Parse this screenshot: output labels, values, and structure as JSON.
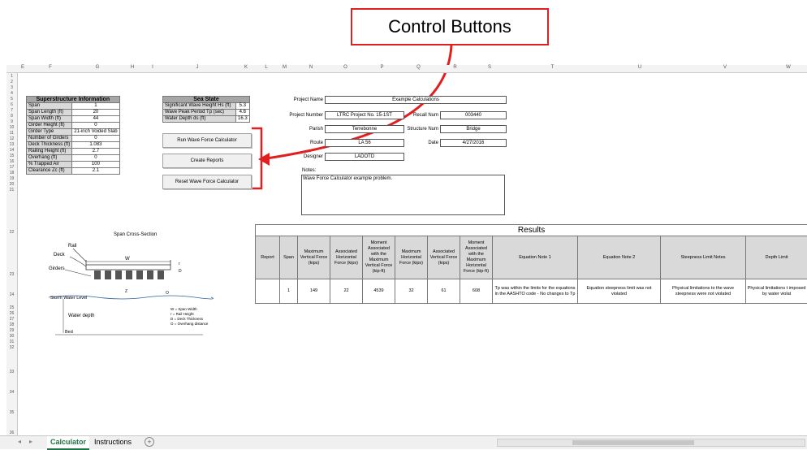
{
  "callout": {
    "label": "Control Buttons"
  },
  "columns": [
    "E",
    "F",
    "G",
    "H",
    "I",
    "J",
    "K",
    "L",
    "M",
    "N",
    "O",
    "P",
    "Q",
    "R",
    "S",
    "T",
    "U",
    "V",
    "W"
  ],
  "rows": [
    "1",
    "2",
    "3",
    "4",
    "5",
    "6",
    "7",
    "8",
    "9",
    "10",
    "11",
    "12",
    "13",
    "14",
    "15",
    "16",
    "17",
    "18",
    "19",
    "20",
    "21",
    "22",
    "23",
    "24",
    "25",
    "26",
    "27",
    "28",
    "29",
    "30",
    "31",
    "32",
    "33",
    "34",
    "35",
    "36"
  ],
  "superstructure": {
    "title": "Superstructure Information",
    "rows": [
      {
        "label": "Span",
        "value": "1"
      },
      {
        "label": "Span Length (ft)",
        "value": "20"
      },
      {
        "label": "Span Width (ft)",
        "value": "44"
      },
      {
        "label": "Girder Height (ft)",
        "value": "0"
      },
      {
        "label": "Girder Type",
        "value": "21-inch Voided Slab"
      },
      {
        "label": "Number of Girders",
        "value": "0"
      },
      {
        "label": "Deck Thickness (ft)",
        "value": "1.083"
      },
      {
        "label": "Railing Height (ft)",
        "value": "2.7"
      },
      {
        "label": "Overhang (ft)",
        "value": "0"
      },
      {
        "label": "% Trapped Air",
        "value": "100"
      },
      {
        "label": "Clearance Zc (ft)",
        "value": "2.1"
      }
    ]
  },
  "sea_state": {
    "title": "Sea State",
    "rows": [
      {
        "label": "Significant Wave Height Hs (ft)",
        "value": "5.3"
      },
      {
        "label": "Wave Peak Period Tp (sec)",
        "value": "4.6"
      },
      {
        "label": "Water Depth ds (ft)",
        "value": "16.3"
      }
    ]
  },
  "buttons": {
    "run": "Run Wave Force Calculator",
    "reports": "Create Reports",
    "reset": "Reset Wave Force Calculator"
  },
  "project": {
    "name_label": "Project Name",
    "name_value": "Example Calculations",
    "number_label": "Project Number",
    "number_value": "LTRC Project No. 15-1ST",
    "recall_label": "Recall Num",
    "recall_value": "003440",
    "parish_label": "Parish",
    "parish_value": "Terrebonne",
    "structure_label": "Structure Num",
    "structure_value": "Bridge",
    "route_label": "Route",
    "route_value": "LA 56",
    "date_label": "Date",
    "date_value": "4/27/2016",
    "designer_label": "Designer",
    "designer_value": "LADOTD",
    "notes_label": "Notes:",
    "notes_value": "Wave Force Calculator example problem."
  },
  "diagram": {
    "title": "Span Cross-Section",
    "rail": "Rail",
    "deck": "Deck",
    "girders": "Girders",
    "w": "W",
    "r": "r",
    "d": "D",
    "storm": "Storm Water Level",
    "zc": "Z",
    "o": "O",
    "water_depth": "Water depth",
    "bed": "Bed",
    "legend": [
      "W = Span Width",
      "r = Rail Height",
      "D = Deck Thickness",
      "O = Overhang distance"
    ]
  },
  "results": {
    "title": "Results",
    "headers": [
      "Report",
      "Span",
      "Maximum Vertical Force (kips)",
      "Associated Horizontal Force (kips)",
      "Moment Associated with the Maximum Vertical Force (kip-ft)",
      "Maximum Horizontal Force (kips)",
      "Associated Vertical Force (kips)",
      "Moment Associated with the Maximum Horizontal Force (kip-ft)",
      "Equation Note 1",
      "Equation Note 2",
      "Steepness Limit Notes",
      "Depth Limit"
    ],
    "row": [
      "",
      "1",
      "149",
      "22",
      "4539",
      "32",
      "61",
      "608",
      "Tp was within the limits for the equations in the AASHTO code - No changes to Tp",
      "Equation steepness limit was not violated",
      "Physical limitations to the wave steepness were not violated",
      "Physical limitations t imposed by water violat"
    ]
  },
  "tabs": [
    "Calculator",
    "Instructions"
  ],
  "colors": {
    "accent": "#217346",
    "callout": "#e02020"
  }
}
